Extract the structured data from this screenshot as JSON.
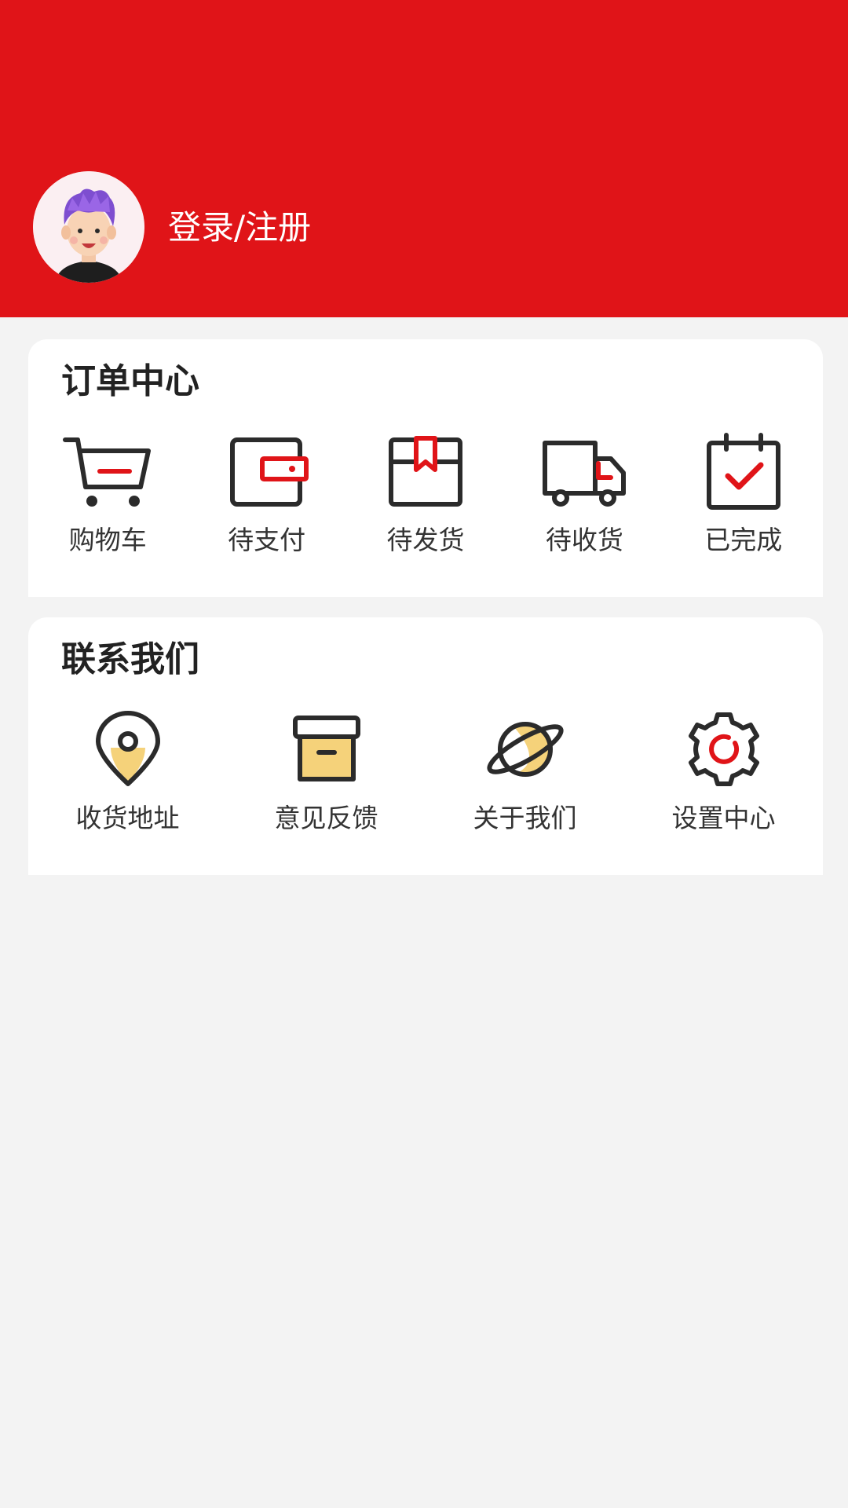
{
  "header": {
    "login_label": "登录/注册",
    "background_color": "#e01418"
  },
  "orders": {
    "title": "订单中心",
    "items": [
      {
        "label": "购物车",
        "icon": "shopping-cart-icon"
      },
      {
        "label": "待支付",
        "icon": "wallet-icon"
      },
      {
        "label": "待发货",
        "icon": "package-box-icon"
      },
      {
        "label": "待收货",
        "icon": "delivery-truck-icon"
      },
      {
        "label": "已完成",
        "icon": "calendar-check-icon"
      }
    ]
  },
  "contact": {
    "title": "联系我们",
    "items": [
      {
        "label": "收货地址",
        "icon": "location-pin-icon"
      },
      {
        "label": "意见反馈",
        "icon": "archive-box-icon"
      },
      {
        "label": "关于我们",
        "icon": "planet-icon"
      },
      {
        "label": "设置中心",
        "icon": "gear-icon"
      }
    ]
  },
  "colors": {
    "accent": "#e01418",
    "icon_stroke": "#2b2b2b",
    "icon_highlight": "#f5d27a"
  }
}
